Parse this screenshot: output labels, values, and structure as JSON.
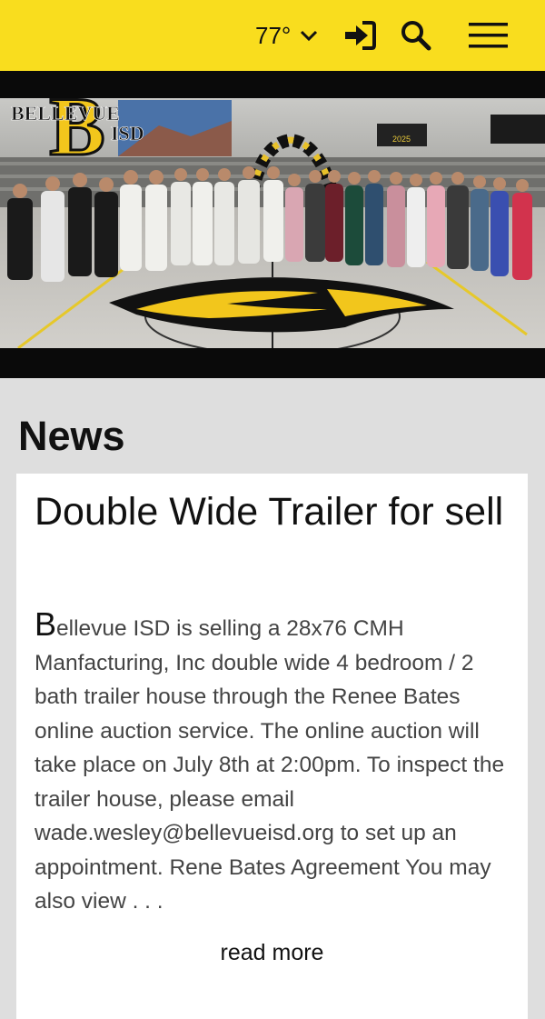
{
  "header": {
    "weather_temp": "77°",
    "weather_icon": "chevron-down-icon",
    "signin_icon": "sign-in-icon",
    "search_icon": "search-icon",
    "menu_icon": "menu-icon",
    "brand_color": "#f9dd1e"
  },
  "hero": {
    "logo_letter": "B",
    "logo_line1": "BELLEVUE",
    "logo_line2": "ISD",
    "scoreboard_text": "2025"
  },
  "news": {
    "heading": "News",
    "article": {
      "title": "Double Wide Trailer for sell",
      "dropcap": "B",
      "body": "ellevue ISD is selling a 28x76 CMH Manfacturing, Inc double wide 4 bedroom / 2 bath trailer house through the Renee Bates online auction service.  The online auction will take place on July 8th at 2:00pm. To inspect the trailer house, please email wade.wesley@bellevueisd.org to set up an appointment.    Rene Bates Agreement   You may also view . . .",
      "read_more": "read more"
    }
  }
}
